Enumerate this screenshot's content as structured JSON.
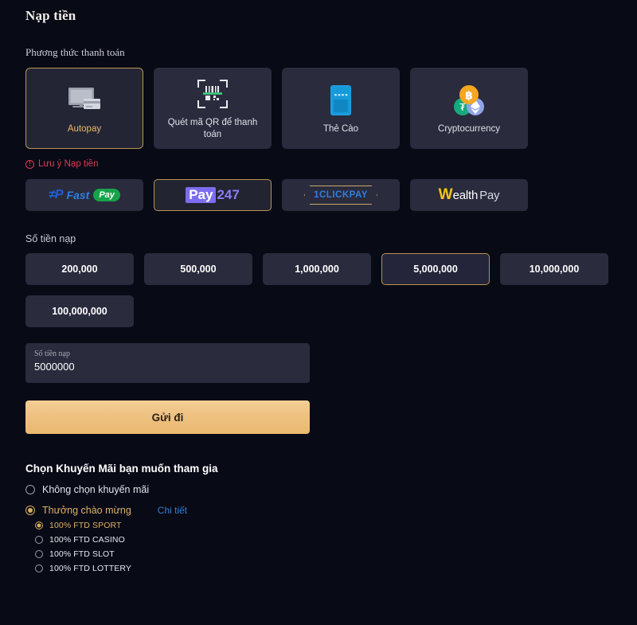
{
  "page": {
    "title": "Nạp tiền"
  },
  "payment_methods": {
    "label": "Phương thức thanh toán",
    "items": [
      {
        "label": "Autopay",
        "icon": "monitor-card-icon",
        "selected": true
      },
      {
        "label": "Quét mã QR để thanh toán",
        "icon": "qr-scan-icon",
        "selected": false
      },
      {
        "label": "Thẻ Cào",
        "icon": "prepaid-card-icon",
        "selected": false
      },
      {
        "label": "Cryptocurrency",
        "icon": "crypto-coins-icon",
        "selected": false
      }
    ]
  },
  "note": {
    "icon": "warning-circle-icon",
    "text": "Lưu ý Nạp tiền"
  },
  "providers": [
    {
      "name": "FastPay",
      "logo": "fastpay-logo",
      "selected": false,
      "parts": {
        "fast": "Fast",
        "pay": "Pay"
      }
    },
    {
      "name": "Pay247",
      "logo": "pay247-logo",
      "selected": true,
      "parts": {
        "pay": "Pay",
        "num": "247"
      }
    },
    {
      "name": "1CLICKPAY",
      "logo": "oneclickpay-logo",
      "selected": false,
      "parts": {
        "text": "1CLICKPAY"
      }
    },
    {
      "name": "WealthPay",
      "logo": "wealthpay-logo",
      "selected": false,
      "parts": {
        "w": "W",
        "ealth": "ealth",
        "pay": "Pay"
      }
    }
  ],
  "amount": {
    "label": "Số tiền nạp",
    "options": [
      {
        "value": "200,000",
        "selected": false
      },
      {
        "value": "500,000",
        "selected": false
      },
      {
        "value": "1,000,000",
        "selected": false
      },
      {
        "value": "5,000,000",
        "selected": true
      },
      {
        "value": "10,000,000",
        "selected": false
      },
      {
        "value": "100,000,000",
        "selected": false
      }
    ],
    "field_label": "Số tiền nạp",
    "field_value": "5000000",
    "field_placeholder": "Số tiền nạp"
  },
  "submit": {
    "label": "Gửi đi"
  },
  "promotions": {
    "title": "Chọn Khuyến Mãi bạn muốn tham gia",
    "options": [
      {
        "label": "Không chọn khuyến mãi",
        "selected": false,
        "highlight": false
      },
      {
        "label": "Thưởng chào mừng",
        "selected": true,
        "highlight": true,
        "detail_label": "Chi tiết"
      }
    ],
    "sub_options": [
      {
        "label": "100% FTD SPORT",
        "selected": true
      },
      {
        "label": "100% FTD CASINO",
        "selected": false
      },
      {
        "label": "100% FTD SLOT",
        "selected": false
      },
      {
        "label": "100% FTD LOTTERY",
        "selected": false
      }
    ]
  },
  "colors": {
    "background": "#080a16",
    "card": "#2a2b3d",
    "accent_gold": "#b9954e",
    "text": "#ffffff",
    "danger": "#e03a4e",
    "link": "#2f80d8"
  }
}
